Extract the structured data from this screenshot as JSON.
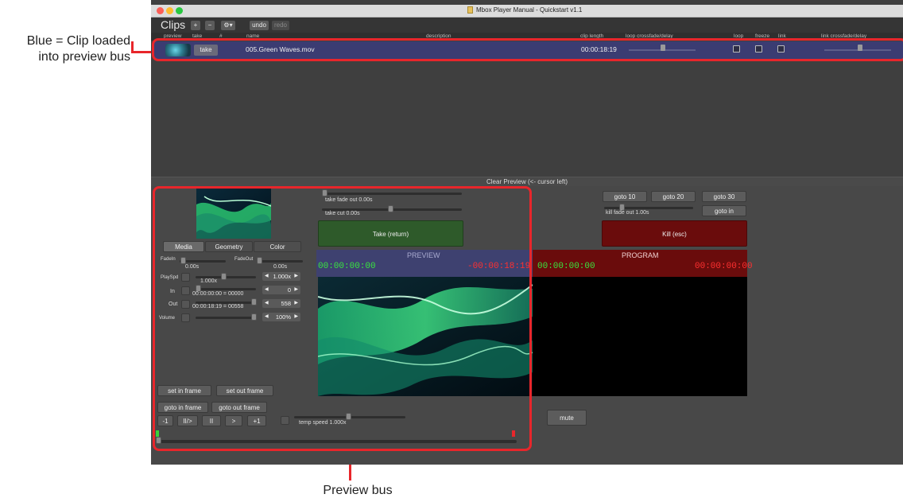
{
  "annotations": {
    "clip_loaded": "Blue = Clip loaded\ninto preview bus",
    "clip_loaded_l1": "Blue = Clip loaded",
    "clip_loaded_l2": "into preview bus",
    "preview_bus": "Preview bus"
  },
  "window": {
    "title": "Mbox Player Manual - Quickstart v1.1"
  },
  "toolbar": {
    "title": "Clips",
    "add_icon": "plus-circle-icon",
    "remove_icon": "minus-circle-icon",
    "settings_icon": "gear-icon",
    "undo": "undo",
    "redo": "redo"
  },
  "columns": [
    "preview",
    "take",
    "#",
    "name",
    "description",
    "clip length",
    "loop crossfade/delay",
    "loop",
    "freeze",
    "link",
    "link crossfade/delay"
  ],
  "clip": {
    "take": "take",
    "name": "005.Green Waves.mov",
    "length": "00:00:18:19"
  },
  "clear_preview": "Clear Preview (<- cursor left)",
  "preview_panel": {
    "tabs": [
      "Media",
      "Geometry",
      "Color"
    ],
    "fadein_label": "FadeIn",
    "fadein_value": "0.00s",
    "fadeout_label": "FadeOut",
    "fadeout_value": "0.00s",
    "playspd_label": "PlaySpd",
    "playspd_value": "1.000x",
    "playspd_stepper": "1.000x",
    "in_label": "In",
    "in_value": "00:00:00:00 = 00000",
    "in_stepper": "0",
    "out_label": "Out",
    "out_value": "00:00:18:19 = 00558",
    "out_stepper": "558",
    "volume_label": "Volume",
    "volume_stepper": "100%",
    "set_in_frame": "set in frame",
    "set_out_frame": "set out frame",
    "goto_in_frame": "goto in frame",
    "goto_out_frame": "goto out frame",
    "transport": [
      "-1",
      "II/>",
      "II",
      ">",
      "+1"
    ],
    "temp_speed": "temp speed 1.000x"
  },
  "take_controls": {
    "fade_out": "take fade out 0.00s",
    "cut": "take cut 0.00s",
    "take_button": "Take (return)"
  },
  "preview_monitor": {
    "label": "PREVIEW",
    "tc_left": "00:00:00:00",
    "tc_right": "-00:00:18:19"
  },
  "program_controls": {
    "goto10": "goto 10",
    "goto20": "goto 20",
    "goto30": "goto 30",
    "goto_in": "goto in",
    "kill_fade": "kill fade out 1.00s",
    "kill_button": "Kill (esc)",
    "mute": "mute"
  },
  "program_monitor": {
    "label": "PROGRAM",
    "tc_left": "00:00:00:00",
    "tc_right": "00:00:00:00"
  },
  "colors": {
    "accent_red": "#e8262b",
    "clip_row_blue": "#3b3c72",
    "take_green": "#2e5a2a",
    "kill_red": "#6a0c0c",
    "tc_green": "#39e63f",
    "tc_red": "#ff3030"
  }
}
